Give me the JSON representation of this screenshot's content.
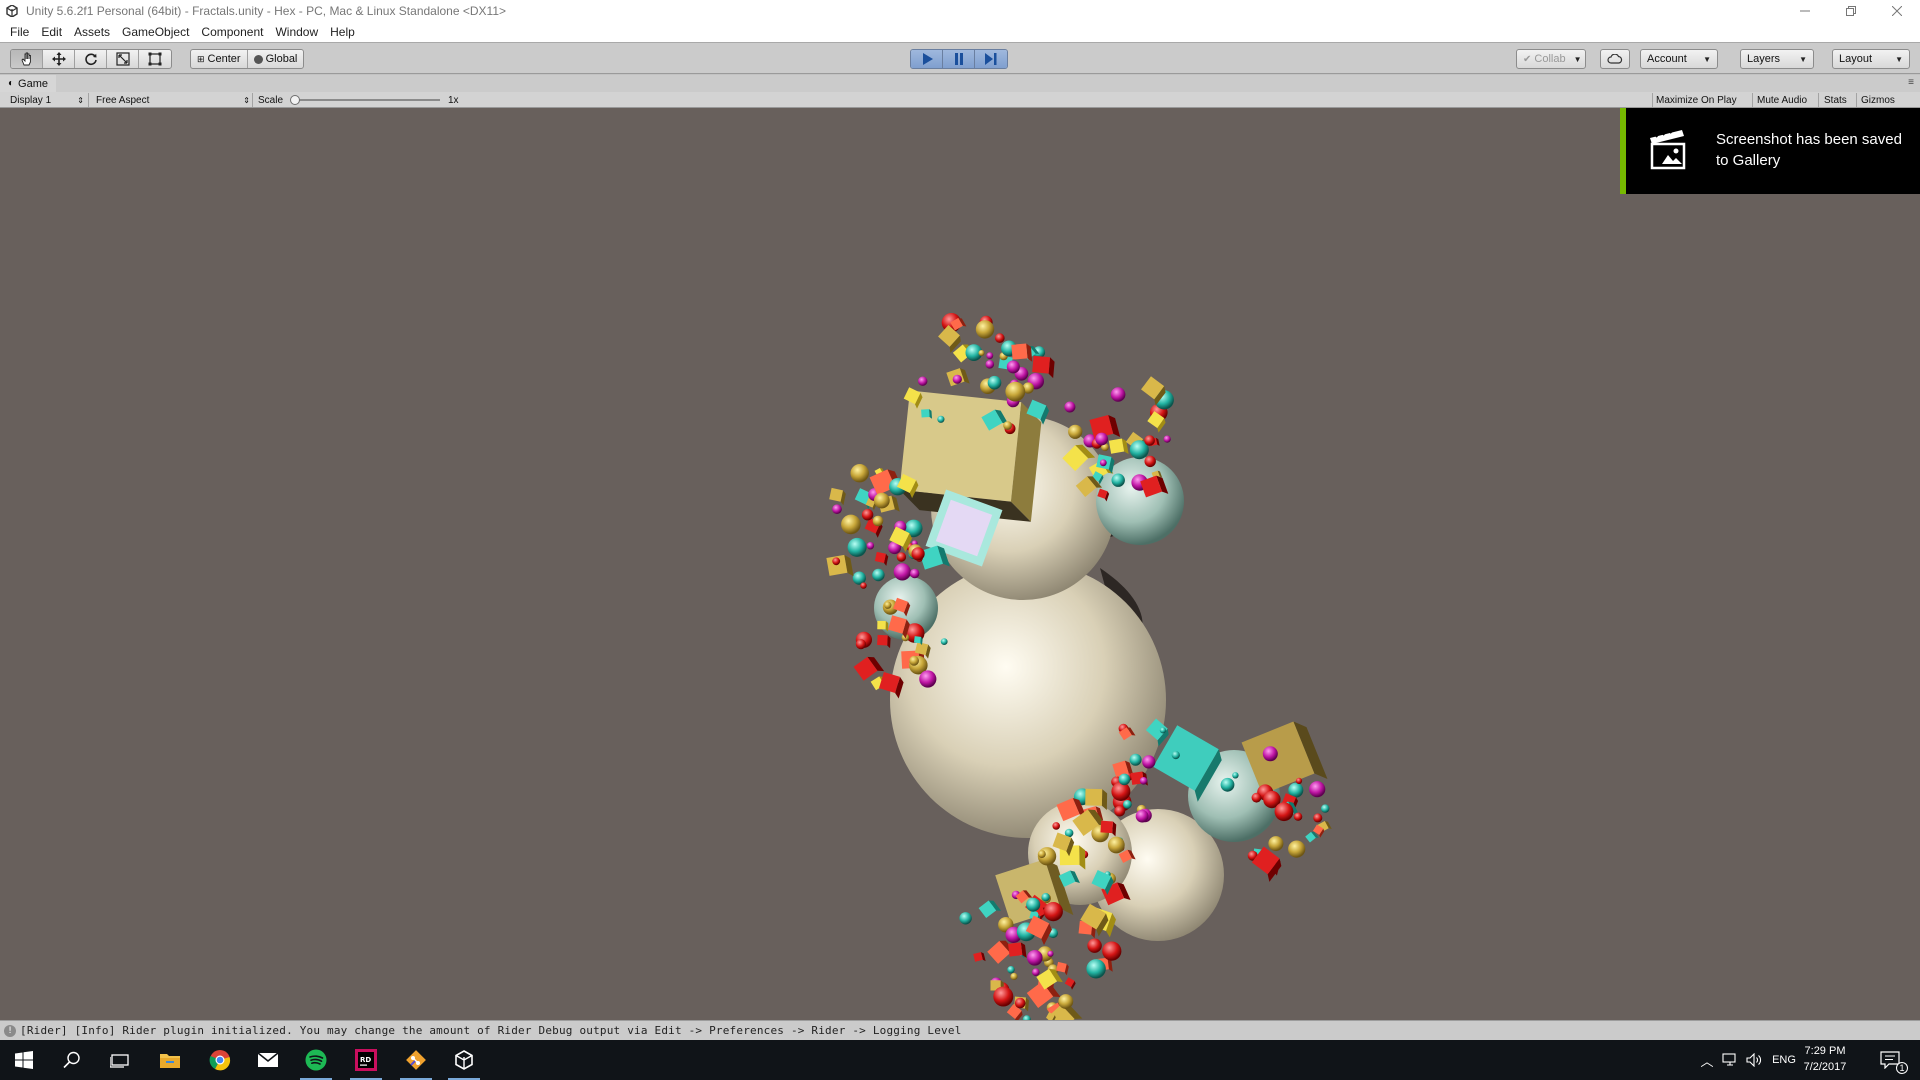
{
  "window": {
    "title": "Unity 5.6.2f1 Personal (64bit) - Fractals.unity - Hex - PC, Mac & Linux Standalone <DX11>",
    "controls": [
      "minimize-icon",
      "restore-icon",
      "close-icon"
    ]
  },
  "menu": [
    "File",
    "Edit",
    "Assets",
    "GameObject",
    "Component",
    "Window",
    "Help"
  ],
  "toolbar": {
    "transform_tools": [
      "hand-icon",
      "move-icon",
      "rotate-icon",
      "scale-icon",
      "rect-icon"
    ],
    "pivot_mode": "Center",
    "pivot_rotation": "Global",
    "play_controls": [
      "play-icon",
      "pause-icon",
      "step-icon"
    ],
    "collab": "Collab",
    "account": "Account",
    "layers": "Layers",
    "layout": "Layout"
  },
  "game_view": {
    "tab": "Game",
    "display": "Display 1",
    "aspect": "Free Aspect",
    "scale_label": "Scale",
    "scale_value": "1x",
    "maximize_on_play": "Maximize On Play",
    "mute_audio": "Mute Audio",
    "stats": "Stats",
    "gizmos": "Gizmos"
  },
  "toast": {
    "message": "Screenshot has been saved to Gallery"
  },
  "status": {
    "message": "[Rider] [Info] Rider plugin initialized. You may change the amount of Rider Debug output via Edit -> Preferences -> Rider -> Logging Level"
  },
  "taskbar": {
    "apps": [
      "windows-start-icon",
      "search-icon",
      "task-view-icon",
      "file-explorer-icon",
      "chrome-icon",
      "mail-icon",
      "spotify-icon",
      "rider-icon",
      "git-icon",
      "unity-icon"
    ],
    "language": "ENG",
    "time": "7:29 PM",
    "date": "7/2/2017",
    "notification_count": "1"
  },
  "colors": {
    "viewport_bg": "#68605c",
    "toast_accent": "#76b900",
    "play_active": "#7f9fcf"
  }
}
